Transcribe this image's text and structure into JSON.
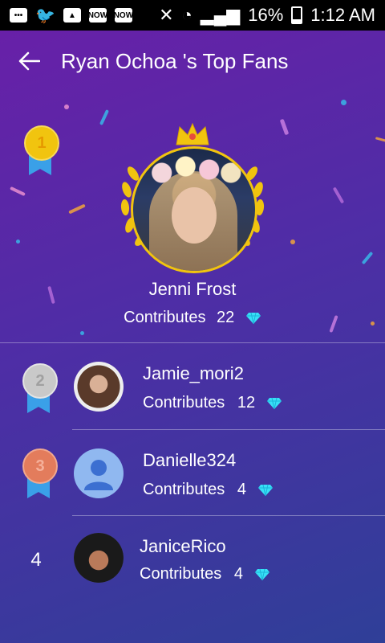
{
  "status": {
    "battery": "16%",
    "time": "1:12 AM",
    "now1": "NOW",
    "now2": "NOW"
  },
  "header": {
    "title": "Ryan Ochoa 's Top Fans"
  },
  "top_fan": {
    "rank": "1",
    "name": "Jenni Frost",
    "contrib_label": "Contributes",
    "count": "22"
  },
  "fans": [
    {
      "rank": "2",
      "name": "Jamie_mori2",
      "contrib_label": "Contributes",
      "count": "12"
    },
    {
      "rank": "3",
      "name": "Danielle324",
      "contrib_label": "Contributes",
      "count": "4"
    },
    {
      "rank": "4",
      "name": "JaniceRico",
      "contrib_label": "Contributes",
      "count": "4"
    }
  ],
  "colors": {
    "gold": "#f1c40f",
    "silver": "#c9c9c9",
    "bronze": "#e37c5c",
    "diamond": "#37e0f7",
    "ribbon": "#3aa0e8"
  },
  "icons": [
    "back-arrow-icon",
    "crown-icon",
    "laurel-wreath-icon",
    "diamond-icon",
    "medal-gold-icon",
    "medal-silver-icon",
    "medal-bronze-icon",
    "default-avatar-icon"
  ]
}
